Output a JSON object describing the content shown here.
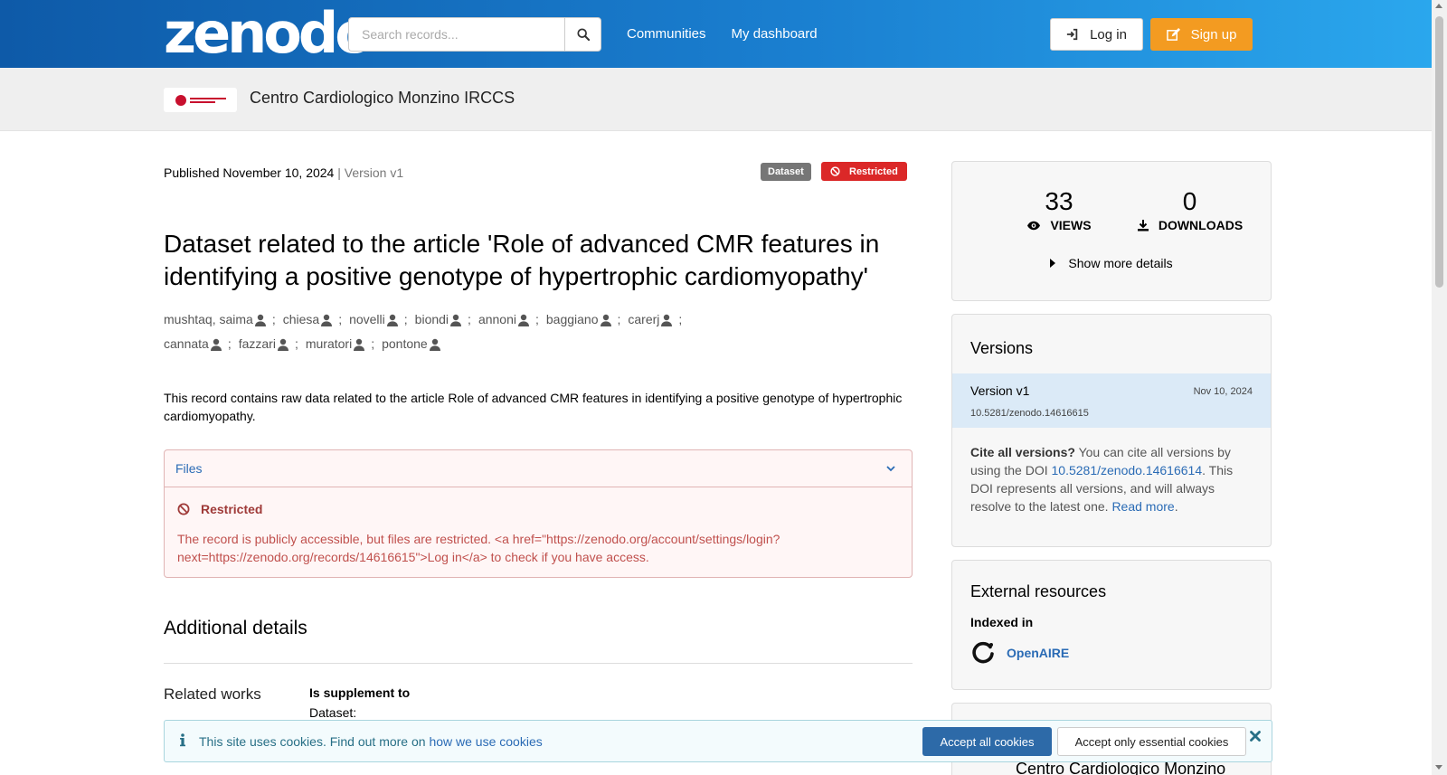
{
  "header": {
    "logo_text": "zenodo",
    "search_placeholder": "Search records...",
    "nav": [
      "Communities",
      "My dashboard"
    ],
    "login_label": "Log in",
    "signup_label": "Sign up"
  },
  "community": {
    "name": "Centro Cardiologico Monzino IRCCS"
  },
  "record": {
    "published": "Published November 10, 2024",
    "version_text": "| Version v1",
    "badge_type": "Dataset",
    "badge_access": "Restricted",
    "title": "Dataset related to the article 'Role of advanced CMR features in identifying a positive genotype of hypertrophic cardiomyopathy'",
    "creators": [
      "mushtaq, saima",
      "chiesa",
      "novelli",
      "biondi",
      "annoni",
      "baggiano",
      "carerj",
      "cannata",
      "fazzari",
      "muratori",
      "pontone"
    ],
    "separator": ";",
    "description": "This record contains raw data related to the article Role of advanced CMR features in identifying a positive genotype of hypertrophic cardiomyopathy."
  },
  "files": {
    "label": "Files",
    "restricted_title": "Restricted",
    "restricted_message": "The record is publicly accessible, but files are restricted. <a href=\"https://zenodo.org/account/settings/login?next=https://zenodo.org/records/14616615\">Log in</a> to check if you have access."
  },
  "additional": {
    "heading": "Additional details",
    "related_works_label": "Related works",
    "relation": "Is supplement to",
    "relation_type": "Dataset:"
  },
  "stats": {
    "views": "33",
    "views_label": "VIEWS",
    "downloads": "0",
    "downloads_label": "DOWNLOADS",
    "show_more": "Show more details"
  },
  "versions": {
    "heading": "Versions",
    "current_label": "Version v1",
    "current_date": "Nov 10, 2024",
    "current_doi": "10.5281/zenodo.14616615",
    "cite_bold": "Cite all versions?",
    "cite_text_1": " You can cite all versions by using the DOI ",
    "cite_doi": "10.5281/zenodo.14616614",
    "cite_text_2": ". This DOI represents all versions, and will always resolve to the latest one. ",
    "read_more": "Read more",
    "cite_end": "."
  },
  "external": {
    "heading": "External resources",
    "indexed_in": "Indexed in",
    "resource": "OpenAIRE"
  },
  "partial_card": {
    "name": "Centro Cardiologico Monzino"
  },
  "cookie": {
    "text": "This site uses cookies. Find out more on ",
    "link": "how we use cookies",
    "accept_all": "Accept all cookies",
    "accept_essential": "Accept only essential cookies"
  },
  "colors": {
    "header_gradient_start": "#0e5aa8",
    "header_gradient_end": "#2ba8ee",
    "signup": "#f39b21",
    "restricted": "#db2828",
    "link": "#2a6bb5"
  }
}
